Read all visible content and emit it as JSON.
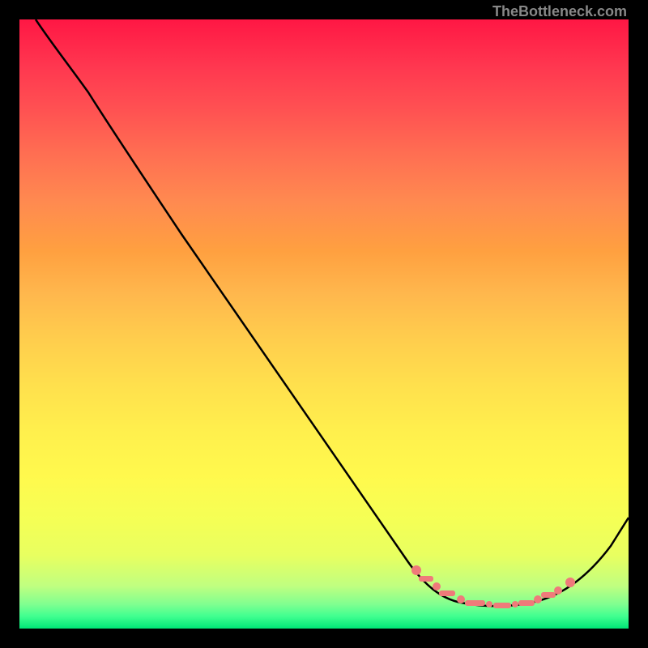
{
  "watermark": "TheBottleneck.com",
  "chart_data": {
    "type": "line",
    "title": "",
    "xlabel": "",
    "ylabel": "",
    "xlim": [
      0,
      100
    ],
    "ylim": [
      0,
      100
    ],
    "series": [
      {
        "name": "curve",
        "color": "#000000",
        "x": [
          0,
          5,
          10,
          20,
          30,
          40,
          50,
          60,
          66,
          70,
          75,
          80,
          85,
          90,
          100
        ],
        "y": [
          100,
          97,
          93,
          80,
          66,
          52,
          38,
          23,
          12,
          8,
          5,
          5,
          6,
          10,
          25
        ]
      }
    ],
    "markers": {
      "name": "plateau-markers",
      "color": "#e57373",
      "x": [
        65.5,
        67,
        70,
        72,
        74,
        76,
        78,
        80,
        82,
        84,
        86,
        88,
        89.5
      ],
      "y": [
        12,
        10,
        7.5,
        6.5,
        6,
        5.5,
        5.5,
        5.5,
        6,
        7,
        8,
        10,
        12
      ]
    },
    "gradient_stops": [
      {
        "pos": 0,
        "color": "#ff1744"
      },
      {
        "pos": 50,
        "color": "#ffcc4d"
      },
      {
        "pos": 85,
        "color": "#f5ff55"
      },
      {
        "pos": 100,
        "color": "#00e676"
      }
    ]
  }
}
